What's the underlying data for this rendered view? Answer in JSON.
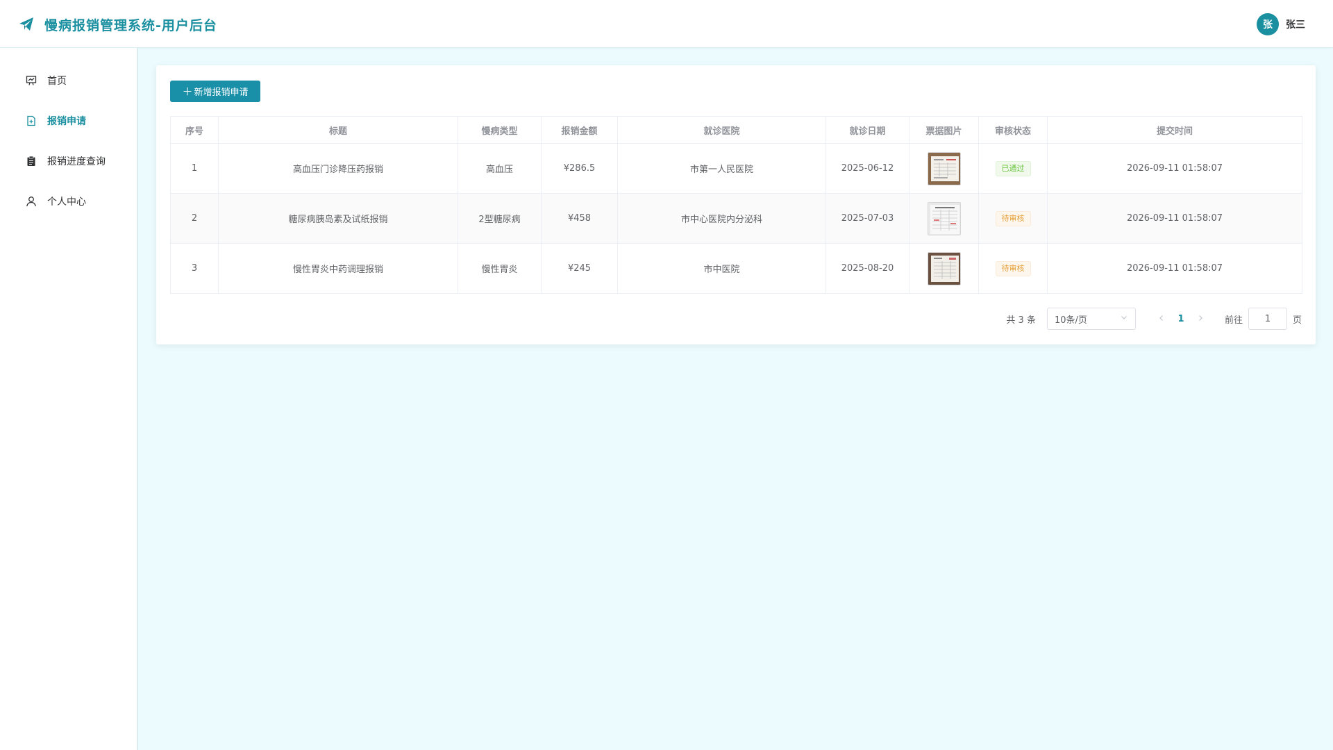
{
  "header": {
    "title": "慢病报销管理系统-用户后台",
    "avatar_text": "张",
    "user_name": "张三"
  },
  "sidebar": {
    "items": [
      {
        "label": "首页",
        "icon": "presentation-icon",
        "active": false
      },
      {
        "label": "报销申请",
        "icon": "document-add-icon",
        "active": true
      },
      {
        "label": "报销进度查询",
        "icon": "clipboard-icon",
        "active": false
      },
      {
        "label": "个人中心",
        "icon": "user-icon",
        "active": false
      }
    ]
  },
  "toolbar": {
    "add_label": "新增报销申请",
    "add_icon": "plus-icon"
  },
  "table": {
    "columns": [
      "序号",
      "标题",
      "慢病类型",
      "报销金额",
      "就诊医院",
      "就诊日期",
      "票据图片",
      "审核状态",
      "提交时间"
    ],
    "rows": [
      {
        "index": "1",
        "title": "高血压门诊降压药报销",
        "type": "高血压",
        "amount": "¥286.5",
        "hospital": "市第一人民医院",
        "date": "2025-06-12",
        "status": "已通过",
        "status_kind": "ok",
        "submitted": "2026-09-11 01:58:07"
      },
      {
        "index": "2",
        "title": "糖尿病胰岛素及试纸报销",
        "type": "2型糖尿病",
        "amount": "¥458",
        "hospital": "市中心医院内分泌科",
        "date": "2025-07-03",
        "status": "待审核",
        "status_kind": "wait",
        "submitted": "2026-09-11 01:58:07"
      },
      {
        "index": "3",
        "title": "慢性胃炎中药调理报销",
        "type": "慢性胃炎",
        "amount": "¥245",
        "hospital": "市中医院",
        "date": "2025-08-20",
        "status": "待审核",
        "status_kind": "wait",
        "submitted": "2026-09-11 01:58:07"
      }
    ]
  },
  "pagination": {
    "total": "共 3 条",
    "page_size": "10条/页",
    "current_page": "1",
    "goto_label": "前往",
    "goto_value": "1",
    "page_suffix": "页"
  },
  "colors": {
    "primary": "#1a8fa0",
    "background": "#ecfcfe",
    "success": "#67c23a",
    "warning": "#e6a23c"
  }
}
